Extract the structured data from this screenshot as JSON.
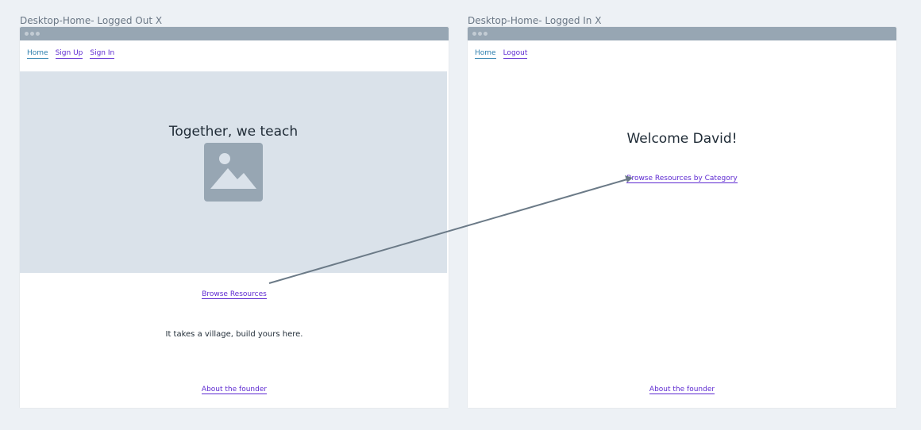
{
  "frames": [
    {
      "title": "Desktop-Home- Logged Out X",
      "nav": [
        "Home",
        "Sign Up",
        "Sign In"
      ],
      "hero_title": "Together, we teach",
      "browse_link": "Browse Resources",
      "tagline": "It takes a village, build yours here.",
      "footer_link": "About the founder"
    },
    {
      "title": "Desktop-Home- Logged In X",
      "nav": [
        "Home",
        "Logout"
      ],
      "welcome": "Welcome David!",
      "browse_link": "Browse Resources by Category",
      "footer_link": "About the founder"
    }
  ],
  "colors": {
    "canvas": "#edf1f5",
    "chrome": "#97a6b3",
    "hero": "#dae2ea",
    "link": "#5e2ad1",
    "current_link": "#2d7fae",
    "connector": "#6b7a87"
  },
  "icons": {
    "hero_placeholder": "image-placeholder-icon",
    "connector": "arrow-icon"
  }
}
